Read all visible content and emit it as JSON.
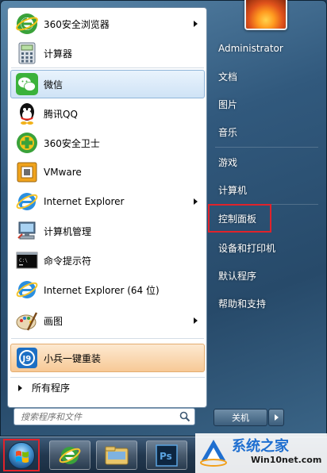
{
  "programs": [
    {
      "label": "360安全浏览器",
      "icon": "360-browser-icon",
      "has_arrow": true
    },
    {
      "label": "计算器",
      "icon": "calculator-icon",
      "has_arrow": false
    },
    {
      "label": "微信",
      "icon": "wechat-icon",
      "has_arrow": false
    },
    {
      "label": "腾讯QQ",
      "icon": "qq-icon",
      "has_arrow": false
    },
    {
      "label": "360安全卫士",
      "icon": "360-security-icon",
      "has_arrow": false
    },
    {
      "label": "VMware",
      "icon": "vmware-icon",
      "has_arrow": false
    },
    {
      "label": "Internet Explorer",
      "icon": "ie-icon",
      "has_arrow": true
    },
    {
      "label": "计算机管理",
      "icon": "computer-management-icon",
      "has_arrow": false
    },
    {
      "label": "命令提示符",
      "icon": "cmd-icon",
      "has_arrow": false
    },
    {
      "label": "Internet Explorer (64 位)",
      "icon": "ie-icon",
      "has_arrow": false
    },
    {
      "label": "画图",
      "icon": "paint-icon",
      "has_arrow": true
    },
    {
      "label": "小兵一键重装",
      "icon": "xiaobing-reinstall-icon",
      "has_arrow": false
    }
  ],
  "all_programs_label": "所有程序",
  "search": {
    "placeholder": "搜索程序和文件"
  },
  "right_column": [
    {
      "label": "Administrator"
    },
    {
      "label": "文档"
    },
    {
      "label": "图片"
    },
    {
      "label": "音乐"
    },
    {
      "label": "游戏"
    },
    {
      "label": "计算机"
    },
    {
      "label": "控制面板"
    },
    {
      "label": "设备和打印机"
    },
    {
      "label": "默认程序"
    },
    {
      "label": "帮助和支持"
    }
  ],
  "shutdown_label": "关机",
  "taskbar": {
    "items": [
      "start-orb-icon",
      "ie-icon",
      "file-explorer-icon",
      "photoshop-icon"
    ]
  },
  "watermark": {
    "title": "系统之家",
    "url": "Win10net.com"
  },
  "colors": {
    "highlight_red": "#e0232b",
    "hover_blue": "#cfe3f6",
    "hover_orange": "#f7c996",
    "frame_blue": "#31597d"
  }
}
